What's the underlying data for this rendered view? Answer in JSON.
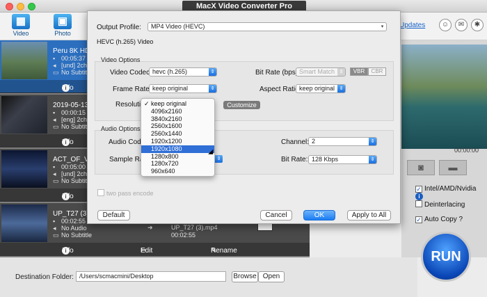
{
  "window": {
    "title": "MacX Video Converter Pro"
  },
  "toolbar": {
    "video_label": "Video",
    "photo_label": "Photo",
    "updates_label": "Updates"
  },
  "items": [
    {
      "title": "Peru 8K HDR ...",
      "duration": "00:05:37",
      "audio": "[und] 2ch",
      "subtitle": "No Subtitle",
      "info_label": "Info"
    },
    {
      "title": "2019-05-13 1...",
      "duration": "00:00:15",
      "audio": "[eng] 2ch",
      "subtitle": "No Subtitle",
      "info_label": "Info"
    },
    {
      "title": "ACT_OF_VALO...",
      "duration": "00:05:00",
      "audio": "[und] 2ch",
      "subtitle": "No Subtitle",
      "info_label": "Info"
    },
    {
      "title": "UP_T27 (3).mp4",
      "duration": "00:02:55",
      "audio": "No Audio",
      "subtitle": "No Subtitle",
      "output_name": "UP_T27 (3).mp4",
      "output_duration": "00:02:55",
      "info_label": "Info",
      "edit_label": "Edit",
      "rename_label": "Rename"
    }
  ],
  "preview": {
    "time": "00:00:00"
  },
  "options": {
    "hw_label": "Intel/AMD/Nvidia",
    "deinterlacing_label": "Deinterlacing",
    "autocopy_label": "Auto Copy"
  },
  "run_label": "RUN",
  "destination": {
    "label": "Destination Folder:",
    "path": "/Users/scmacmini/Desktop",
    "browse_label": "Browse",
    "open_label": "Open"
  },
  "dialog": {
    "output_profile_label": "Output Profile:",
    "output_profile_value": "MP4 Video (HEVC)",
    "profile_caption": "HEVC (h.265) Video",
    "video_group": "Video Options",
    "video_codec_label": "Video Codec:",
    "video_codec_value": "hevc (h.265)",
    "bitrate_label": "Bit Rate (bps):",
    "bitrate_value": "Smart Match",
    "vbr_label": "VBR",
    "cbr_label": "CBR",
    "frame_rate_label": "Frame Rate:",
    "frame_rate_value": "keep original",
    "aspect_label": "Aspect Ratio:",
    "aspect_value": "keep original",
    "resolution_label": "Resolution:",
    "customize_label": "Customize",
    "audio_group": "Audio Options",
    "audio_codec_label": "Audio Codec:",
    "channel_label": "Channel:",
    "channel_value": "2",
    "sample_rate_label": "Sample Rate:",
    "audio_bitrate_label": "Bit Rate:",
    "audio_bitrate_value": "128 Kbps",
    "two_pass_label": "two pass encode",
    "default_label": "Default",
    "cancel_label": "Cancel",
    "ok_label": "OK",
    "apply_all_label": "Apply to All"
  },
  "resolution_menu": {
    "selected": "keep original",
    "highlighted": "1920x1080",
    "options": [
      "keep original",
      "4096x2160",
      "3840x2160",
      "2560x1600",
      "2560x1440",
      "1920x1200",
      "1920x1080",
      "1280x800",
      "1280x720",
      "960x640"
    ]
  }
}
